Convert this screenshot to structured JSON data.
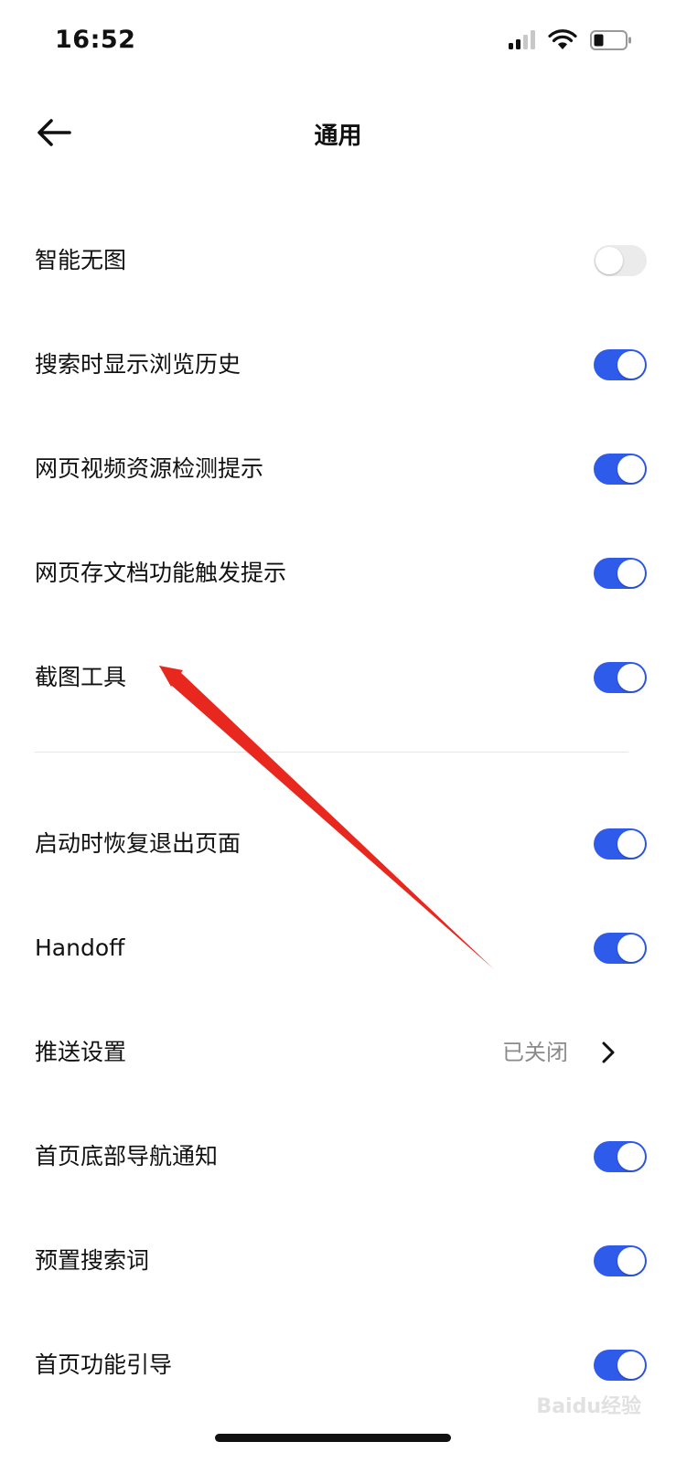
{
  "status_bar": {
    "time": "16:52"
  },
  "nav": {
    "title": "通用"
  },
  "section1": [
    {
      "label": "智能无图",
      "on": false
    },
    {
      "label": "搜索时显示浏览历史",
      "on": true
    },
    {
      "label": "网页视频资源检测提示",
      "on": true
    },
    {
      "label": "网页存文档功能触发提示",
      "on": true
    },
    {
      "label": "截图工具",
      "on": true
    }
  ],
  "section2": [
    {
      "label": "启动时恢复退出页面",
      "on": true
    },
    {
      "label": "Handoff",
      "on": true
    },
    {
      "label": "推送设置",
      "value": "已关闭"
    },
    {
      "label": "首页底部导航通知",
      "on": true
    },
    {
      "label": "预置搜索词",
      "on": true
    },
    {
      "label": "首页功能引导",
      "on": true
    }
  ],
  "watermark": "Baidu经验",
  "colors": {
    "accent": "#2f5bea",
    "toggle_off": "#ebebeb",
    "annotation": "#e8281f"
  }
}
